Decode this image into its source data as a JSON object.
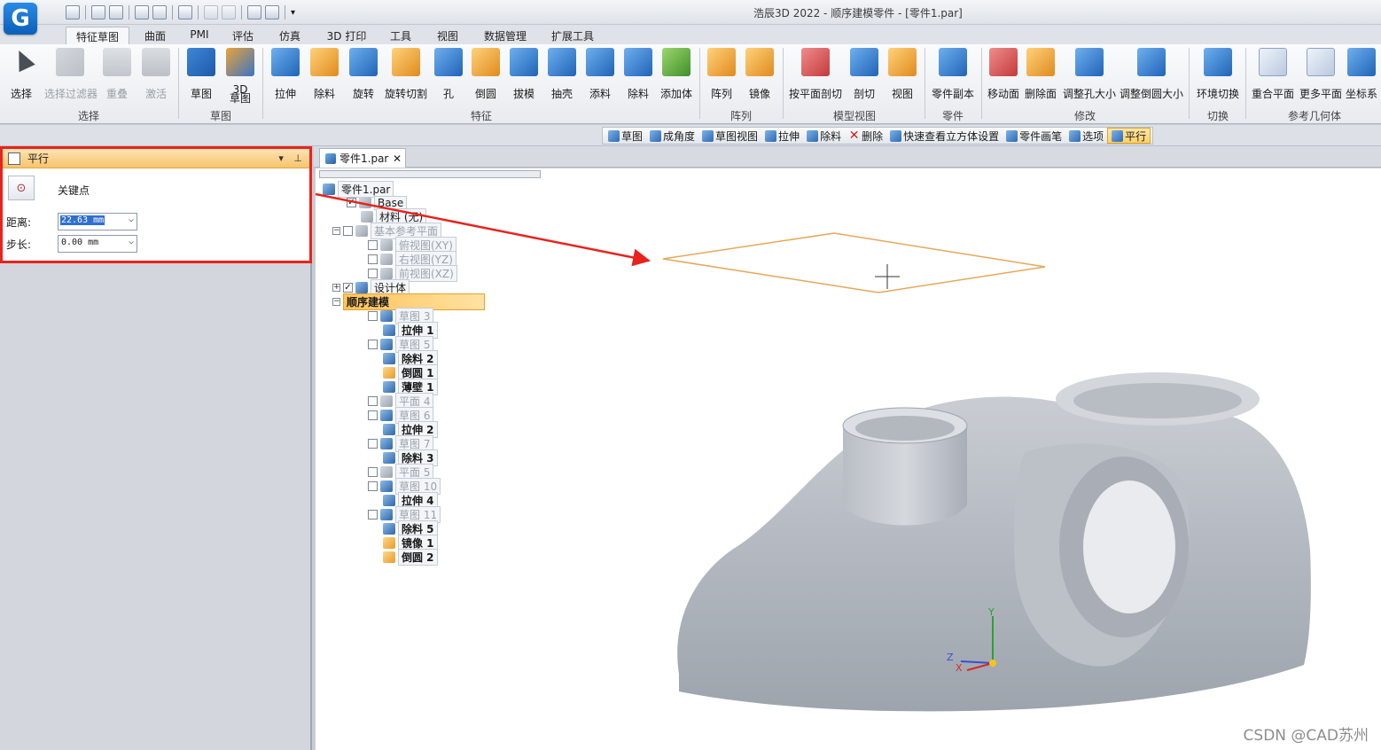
{
  "app": {
    "title": "浩辰3D 2022 - 顺序建模零件 - [零件1.par]",
    "logo_letter": "G"
  },
  "tabs": [
    {
      "label": "特征草图",
      "active": true
    },
    {
      "label": "曲面"
    },
    {
      "label": "PMI"
    },
    {
      "label": "评估"
    },
    {
      "label": "仿真"
    },
    {
      "label": "3D 打印"
    },
    {
      "label": "工具"
    },
    {
      "label": "视图"
    },
    {
      "label": "数据管理"
    },
    {
      "label": "扩展工具"
    }
  ],
  "ribbon": {
    "buttons": {
      "select": "选择",
      "select_filter": "选择过滤器",
      "overlap": "重叠",
      "activate": "激活",
      "sketch": "草图",
      "sketch3d": "3D\n草图",
      "extrude": "拉伸",
      "cut": "除料",
      "revolve": "旋转",
      "revolve_cut": "旋转切割",
      "hole": "孔",
      "round": "倒圆",
      "draft": "拔模",
      "shell": "抽壳",
      "add_material": "添料",
      "remove_material": "除料",
      "add_body": "添加体",
      "pattern": "阵列",
      "mirror": "镜像",
      "plane_section": "按平面剖切",
      "section": "剖切",
      "view": "视图",
      "part_copy": "零件副本",
      "move_face": "移动面",
      "delete_face": "删除面",
      "resize_hole": "调整孔大小",
      "resize_round": "调整倒圆大小",
      "ring_switch": "环境切换",
      "coincident_plane": "重合平面",
      "more_planes": "更多平面",
      "coord_system": "坐标系"
    },
    "groups": {
      "select": "选择",
      "sketch": "草图",
      "feature": "特征",
      "pattern": "阵列",
      "model_view": "模型视图",
      "part": "零件",
      "modify": "修改",
      "switch": "切换",
      "ref_geometry": "参考几何体"
    }
  },
  "command_bar": [
    {
      "label": "草图"
    },
    {
      "label": "成角度"
    },
    {
      "label": "草图视图"
    },
    {
      "label": "拉伸"
    },
    {
      "label": "除料"
    },
    {
      "label": "删除",
      "icon": "delete-icon"
    },
    {
      "label": "快速查看立方体设置"
    },
    {
      "label": "零件画笔"
    },
    {
      "label": "选项"
    },
    {
      "label": "平行",
      "active": true
    }
  ],
  "panel": {
    "title": "平行",
    "keypoint_label": "关键点",
    "distance_label": "距离:",
    "distance_value": "22.63 mm",
    "step_label": "步长:",
    "step_value": "0.00 mm"
  },
  "document_tab": "零件1.par",
  "tree": {
    "root": "零件1.par",
    "items": [
      "Base",
      "材料 (无)",
      "基本参考平面",
      "俯视图(XY)",
      "右视图(YZ)",
      "前视图(XZ)",
      "设计体",
      "顺序建模",
      "草图 3",
      "拉伸 1",
      "草图 5",
      "除料 2",
      "倒圆 1",
      "薄壁 1",
      "平面 4",
      "草图 6",
      "拉伸 2",
      "草图 7",
      "除料 3",
      "平面 5",
      "草图 10",
      "拉伸 4",
      "草图 11",
      "除料 5",
      "镜像 1",
      "倒圆 2"
    ]
  },
  "triad": {
    "x": "X",
    "y": "Y",
    "z": "Z"
  },
  "colors": {
    "highlight_box": "#e8231c",
    "plane_outline": "#e5a85a",
    "panel_header": "#f6c46d",
    "part_body": "#b7bcc4"
  },
  "watermark": "CSDN @CAD苏州"
}
